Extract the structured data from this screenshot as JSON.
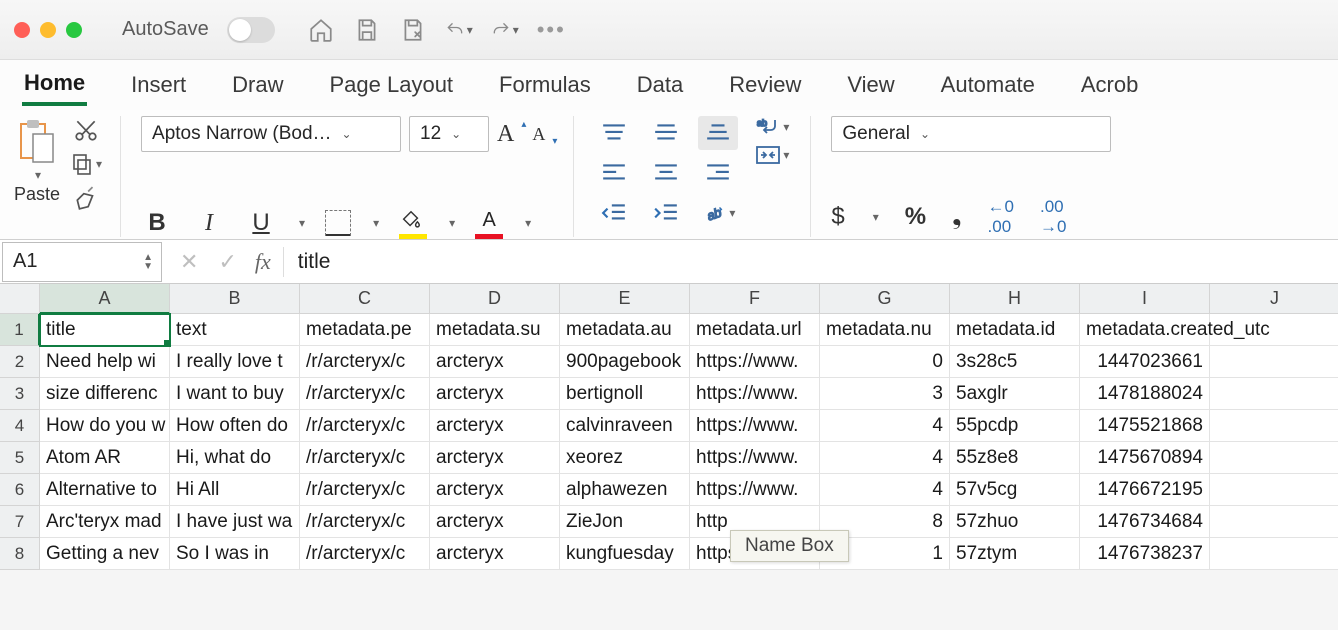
{
  "titlebar": {
    "autosave": "AutoSave"
  },
  "tabs": [
    "Home",
    "Insert",
    "Draw",
    "Page Layout",
    "Formulas",
    "Data",
    "Review",
    "View",
    "Automate",
    "Acrob"
  ],
  "active_tab": 0,
  "clipboard": {
    "paste": "Paste"
  },
  "font": {
    "name": "Aptos Narrow (Bod…",
    "size": "12"
  },
  "number_format": "General",
  "namebox": "A1",
  "formula": "title",
  "tooltip": "Name Box",
  "columns": [
    "A",
    "B",
    "C",
    "D",
    "E",
    "F",
    "G",
    "H",
    "I",
    "J"
  ],
  "rows": [
    [
      "title",
      "text",
      "metadata.pe",
      "metadata.su",
      "metadata.au",
      "metadata.url",
      "metadata.nu",
      "metadata.id",
      "metadata.created_utc",
      ""
    ],
    [
      "Need help wi",
      "I really love t",
      "/r/arcteryx/c",
      "arcteryx",
      "900pagebook",
      "https://www.",
      "0",
      "3s28c5",
      "1447023661",
      ""
    ],
    [
      "size differenc",
      "I want to buy",
      "/r/arcteryx/c",
      "arcteryx",
      "bertignoll",
      "https://www.",
      "3",
      "5axglr",
      "1478188024",
      ""
    ],
    [
      "How do you w",
      "How often do",
      "/r/arcteryx/c",
      "arcteryx",
      "calvinraveen",
      "https://www.",
      "4",
      "55pcdp",
      "1475521868",
      ""
    ],
    [
      "Atom AR",
      "Hi, what do",
      "/r/arcteryx/c",
      "arcteryx",
      "xeorez",
      "https://www.",
      "4",
      "55z8e8",
      "1475670894",
      ""
    ],
    [
      "Alternative to",
      "Hi All",
      "/r/arcteryx/c",
      "arcteryx",
      "alphawezen",
      "https://www.",
      "4",
      "57v5cg",
      "1476672195",
      ""
    ],
    [
      "Arc'teryx mad",
      "I have just wa",
      "/r/arcteryx/c",
      "arcteryx",
      "ZieJon",
      "http",
      "8",
      "57zhuo",
      "1476734684",
      ""
    ],
    [
      "Getting a nev",
      "So I was in",
      "/r/arcteryx/c",
      "arcteryx",
      "kungfuesday",
      "https://www.",
      "1",
      "57ztym",
      "1476738237",
      ""
    ]
  ],
  "numeric_cols": [
    6,
    8
  ]
}
